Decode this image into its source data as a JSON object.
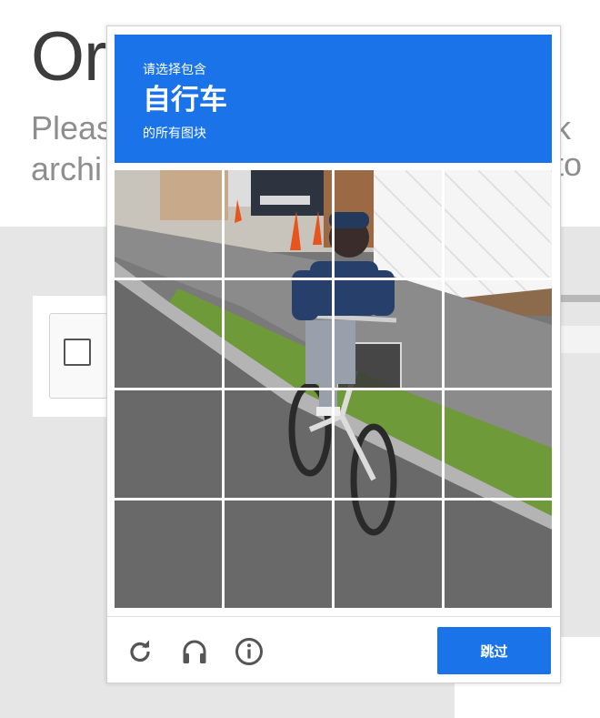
{
  "background_page": {
    "title_partial": "Or",
    "line1_partial": "Pleas",
    "line1_right_partial": "k to",
    "line2_partial": "archi"
  },
  "challenge": {
    "instruction_top": "请选择包含",
    "keyword": "自行车",
    "instruction_bottom": "的所有图块",
    "grid": {
      "rows": 4,
      "columns": 4
    },
    "buttons": {
      "reload_icon": "reload-icon",
      "audio_icon": "headphones-icon",
      "info_icon": "info-icon",
      "skip_label": "跳过"
    }
  },
  "colors": {
    "accent": "#1a73e8",
    "page_gray": "#e6e6e6"
  }
}
